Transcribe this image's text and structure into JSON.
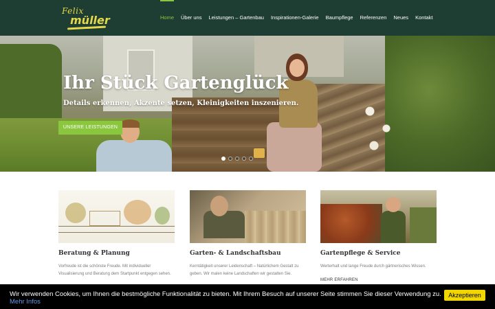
{
  "header": {
    "logo": {
      "top_text": "Felix",
      "main_text": "müller"
    },
    "nav": [
      {
        "label": "Home",
        "active": true
      },
      {
        "label": "Über uns",
        "active": false
      },
      {
        "label": "Leistungen – Gartenbau",
        "active": false
      },
      {
        "label": "Inspirationen-Galerie",
        "active": false
      },
      {
        "label": "Baumpflege",
        "active": false
      },
      {
        "label": "Referenzen",
        "active": false
      },
      {
        "label": "Neues",
        "active": false
      },
      {
        "label": "Kontakt",
        "active": false
      }
    ]
  },
  "hero": {
    "title": "Ihr Stück Gartenglück",
    "subtitle": "Details erkennen, Akzente setzen, Kleinigkeiten inszenieren.",
    "button_label": "UNSERE LEISTUNGEN",
    "slide_count": 5,
    "active_slide": 1
  },
  "cards": [
    {
      "title": "Beratung & Planung",
      "text": "Vorfreude ist die schönste Freude. Mit individueller Visualisierung und Beratung dem Startpunkt entgegen sehen.",
      "link": ""
    },
    {
      "title": "Garten- & Landschaftsbau",
      "text": "Kerntätigkeit unserer Leidenschaft – Natürlichem Gestalt zu geben. Wir malen keine Landschaften wir gestalten Sie.",
      "link": ""
    },
    {
      "title": "Gartenpflege & Service",
      "text": "Werterhalt und lange Freude durch gärtnerisches Wissen.",
      "link": "MEHR ERFAHREN"
    }
  ],
  "cookie": {
    "text": "Wir verwenden Cookies, um Ihnen die bestmögliche Funktionalität zu bieten. Mit Ihrem Besuch auf unserer Seite stimmen Sie dieser Verwendung zu.",
    "link_label": "Mehr Infos",
    "accept_label": "Akzeptieren"
  },
  "colors": {
    "header_bg": "#1e3d33",
    "accent_green": "#8bc63f",
    "logo_yellow": "#e5d84a",
    "cookie_button": "#f1d600"
  }
}
